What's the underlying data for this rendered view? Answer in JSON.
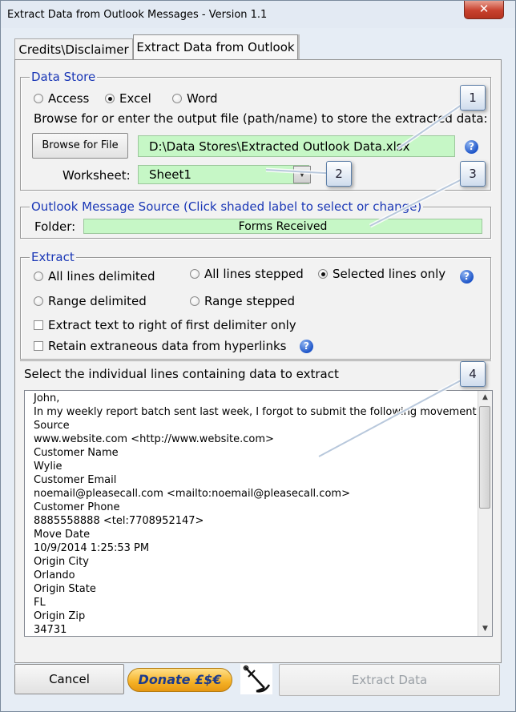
{
  "window": {
    "title": "Extract Data from Outlook Messages - Version 1.1",
    "close_glyph": "✕"
  },
  "tabs": [
    {
      "label": "Credits\\Disclaimer"
    },
    {
      "label": "Extract Data from Outlook"
    }
  ],
  "data_store": {
    "legend": "Data Store",
    "options": [
      "Access",
      "Excel",
      "Word"
    ],
    "selected": "Excel",
    "browse_prompt": "Browse for or enter the output file (path/name) to store the extracted data:",
    "browse_button": "Browse for File",
    "file_path": "D:\\Data Stores\\Extracted Outlook Data.xlsx",
    "worksheet_label": "Worksheet:",
    "worksheet_value": "Sheet1"
  },
  "source": {
    "legend": "Outlook Message Source (Click shaded label to select or change)",
    "folder_label": "Folder:",
    "folder_value": "Forms Received"
  },
  "extract": {
    "legend": "Extract",
    "options": [
      "All lines delimited",
      "All lines stepped",
      "Selected lines only",
      "Range delimited",
      "Range stepped"
    ],
    "selected": "Selected lines only",
    "checkboxes": [
      "Extract text to right of first delimiter only",
      "Retain extraneous data from hyperlinks"
    ]
  },
  "lines_prompt": "Select the individual lines containing data to extract",
  "message_lines": [
    "John,",
    "In my weekly report batch sent last week, I forgot to submit the following movement transac",
    "Source",
    "www.website.com <http://www.website.com>",
    "Customer Name",
    "Wylie",
    "Customer Email",
    "noemail@pleasecall.com <mailto:noemail@pleasecall.com>",
    "Customer Phone",
    "8885558888 <tel:7708952147>",
    "Move Date",
    "10/9/2014 1:25:53 PM",
    "Origin City",
    "Orlando",
    "Origin State",
    "FL",
    "Origin Zip",
    "34731"
  ],
  "callouts": [
    "1",
    "2",
    "3",
    "4"
  ],
  "footer": {
    "cancel": "Cancel",
    "donate": "Donate £$€",
    "extract": "Extract Data"
  },
  "icons": {
    "help": "help-icon",
    "anchor": "anchor-icon",
    "scroll_up": "▲",
    "scroll_down": "▼",
    "dropdown": "▼",
    "help_glyph": "?"
  },
  "colors": {
    "field_green": "#c6f7c6",
    "legend_blue": "#1a37b6",
    "help_blue": "#1f56c9"
  }
}
